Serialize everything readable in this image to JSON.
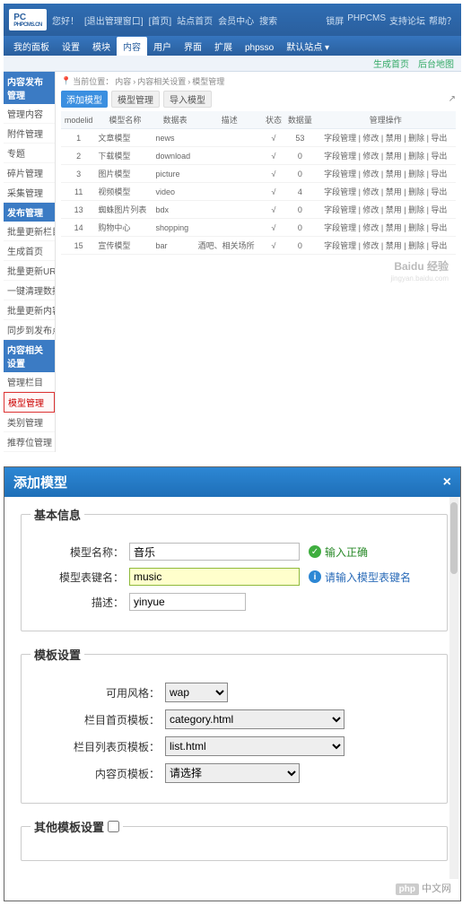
{
  "top": {
    "logo": "PC",
    "logo_sub": "PHPCMS.CN",
    "welcome_links": [
      "您好！",
      "[退出管理窗口]",
      "[首页]",
      "站点首页",
      "会员中心",
      "搜索"
    ],
    "right_links": [
      "锁屏",
      "PHPCMS",
      "支持论坛",
      "帮助？"
    ],
    "nav": [
      "我的面板",
      "设置",
      "模块",
      "内容",
      "用户",
      "界面",
      "扩展",
      "phpsso",
      "默认站点 ▾"
    ],
    "nav_active": 3,
    "subbar": [
      "生成首页",
      "后台地图"
    ],
    "side_head1": "内容发布管理",
    "side1": [
      "管理内容",
      "附件管理",
      "专题",
      "碎片管理",
      "采集管理"
    ],
    "side_head2": "发布管理",
    "side2": [
      "批量更新栏目页",
      "生成首页",
      "批量更新URL",
      "一键清理数据",
      "批量更新内容页",
      "同步到发布点"
    ],
    "side_head3": "内容相关设置",
    "side3": [
      "管理栏目",
      "模型管理",
      "类别管理",
      "推荐位管理"
    ],
    "side3_sel": 1,
    "crumb": [
      "当前位置：",
      "内容",
      "›",
      "内容相关设置",
      "›",
      "模型管理"
    ],
    "actions": {
      "add": "添加模型",
      "manage": "模型管理",
      "import": "导入模型"
    },
    "export_icon": "↗",
    "cols": [
      "modelid",
      "模型名称",
      "数据表",
      "描述",
      "状态",
      "数据量",
      "管理操作"
    ],
    "rows": [
      {
        "id": "1",
        "name": "文章模型",
        "table": "news",
        "desc": "",
        "status": "√",
        "count": "53",
        "ops": "字段管理 | 修改 | 禁用 | 删除 | 导出"
      },
      {
        "id": "2",
        "name": "下载模型",
        "table": "download",
        "desc": "",
        "status": "√",
        "count": "0",
        "ops": "字段管理 | 修改 | 禁用 | 删除 | 导出"
      },
      {
        "id": "3",
        "name": "图片模型",
        "table": "picture",
        "desc": "",
        "status": "√",
        "count": "0",
        "ops": "字段管理 | 修改 | 禁用 | 删除 | 导出"
      },
      {
        "id": "11",
        "name": "视频模型",
        "table": "video",
        "desc": "",
        "status": "√",
        "count": "4",
        "ops": "字段管理 | 修改 | 禁用 | 删除 | 导出"
      },
      {
        "id": "13",
        "name": "蜘蛛图片列表",
        "table": "bdx",
        "desc": "",
        "status": "√",
        "count": "0",
        "ops": "字段管理 | 修改 | 禁用 | 删除 | 导出"
      },
      {
        "id": "14",
        "name": "购物中心",
        "table": "shopping",
        "desc": "",
        "status": "√",
        "count": "0",
        "ops": "字段管理 | 修改 | 禁用 | 删除 | 导出"
      },
      {
        "id": "15",
        "name": "宣传模型",
        "table": "bar",
        "desc": "酒吧、相关场所",
        "status": "√",
        "count": "0",
        "ops": "字段管理 | 修改 | 禁用 | 删除 | 导出"
      }
    ],
    "watermark": "Baidu 经验",
    "watermark_sub": "jingyan.baidu.com"
  },
  "modal": {
    "title": "添加模型",
    "close": "×",
    "fs1": "基本信息",
    "name_label": "模型名称：",
    "name_value": "音乐",
    "name_hint": "输入正确",
    "table_label": "模型表键名：",
    "table_value": "music",
    "table_hint": "请输入模型表键名",
    "desc_label": "描述：",
    "desc_value": "yinyue",
    "fs2": "模板设置",
    "style_label": "可用风格：",
    "style_value": "wap",
    "cat_label": "栏目首页模板：",
    "cat_value": "category.html",
    "list_label": "栏目列表页模板：",
    "list_value": "list.html",
    "show_label": "内容页模板：",
    "show_value": "请选择",
    "fs3": "其他模板设置"
  },
  "brand": {
    "php": "php",
    "cn": "中文网"
  }
}
